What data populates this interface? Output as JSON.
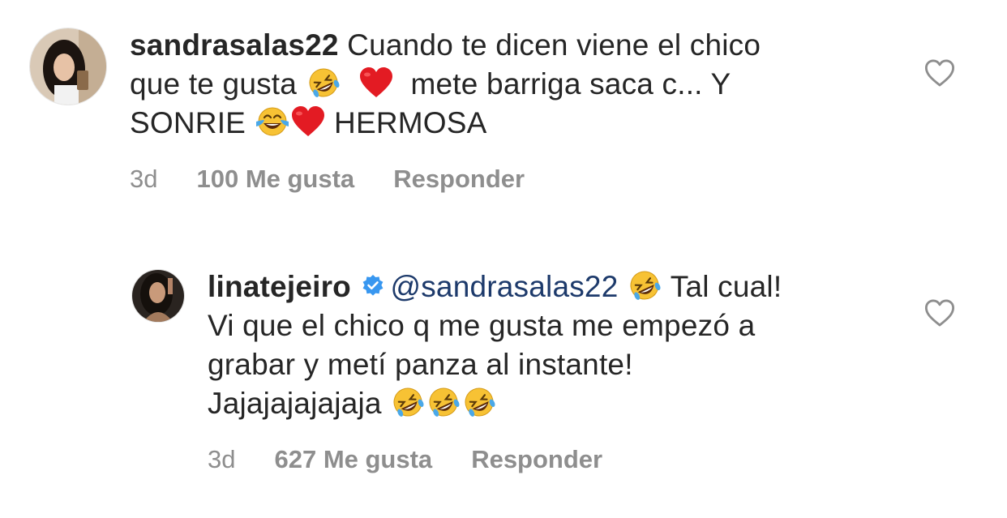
{
  "comments": [
    {
      "username": "sandrasalas22",
      "text_1": "Cuando te dicen viene el chico",
      "text_2": "que te gusta",
      "text_3": "mete barriga saca c... Y",
      "text_4": "SONRIE",
      "text_5": "HERMOSA",
      "time": "3d",
      "likes": "100 Me gusta",
      "reply": "Responder"
    },
    {
      "username": "linatejeiro",
      "mention": "@sandrasalas22",
      "text_1": "Tal cual!",
      "text_2": "Vi que el chico q me gusta me empezó a",
      "text_3": "grabar y metí panza al instante!",
      "text_4": "Jajajajajajaja",
      "time": "3d",
      "likes": "627 Me gusta",
      "reply": "Responder"
    }
  ],
  "icons": {
    "like": "heart-outline-icon",
    "verified": "verified-badge-icon",
    "emoji_rofl": "rolling-on-floor-laughing-emoji",
    "emoji_heart": "red-heart-emoji",
    "emoji_joy": "face-with-tears-of-joy-emoji"
  },
  "colors": {
    "text": "#262626",
    "meta": "#8e8e8e",
    "mention": "#1d3a6b",
    "verified": "#3897f0",
    "heart": "#ed4956"
  }
}
